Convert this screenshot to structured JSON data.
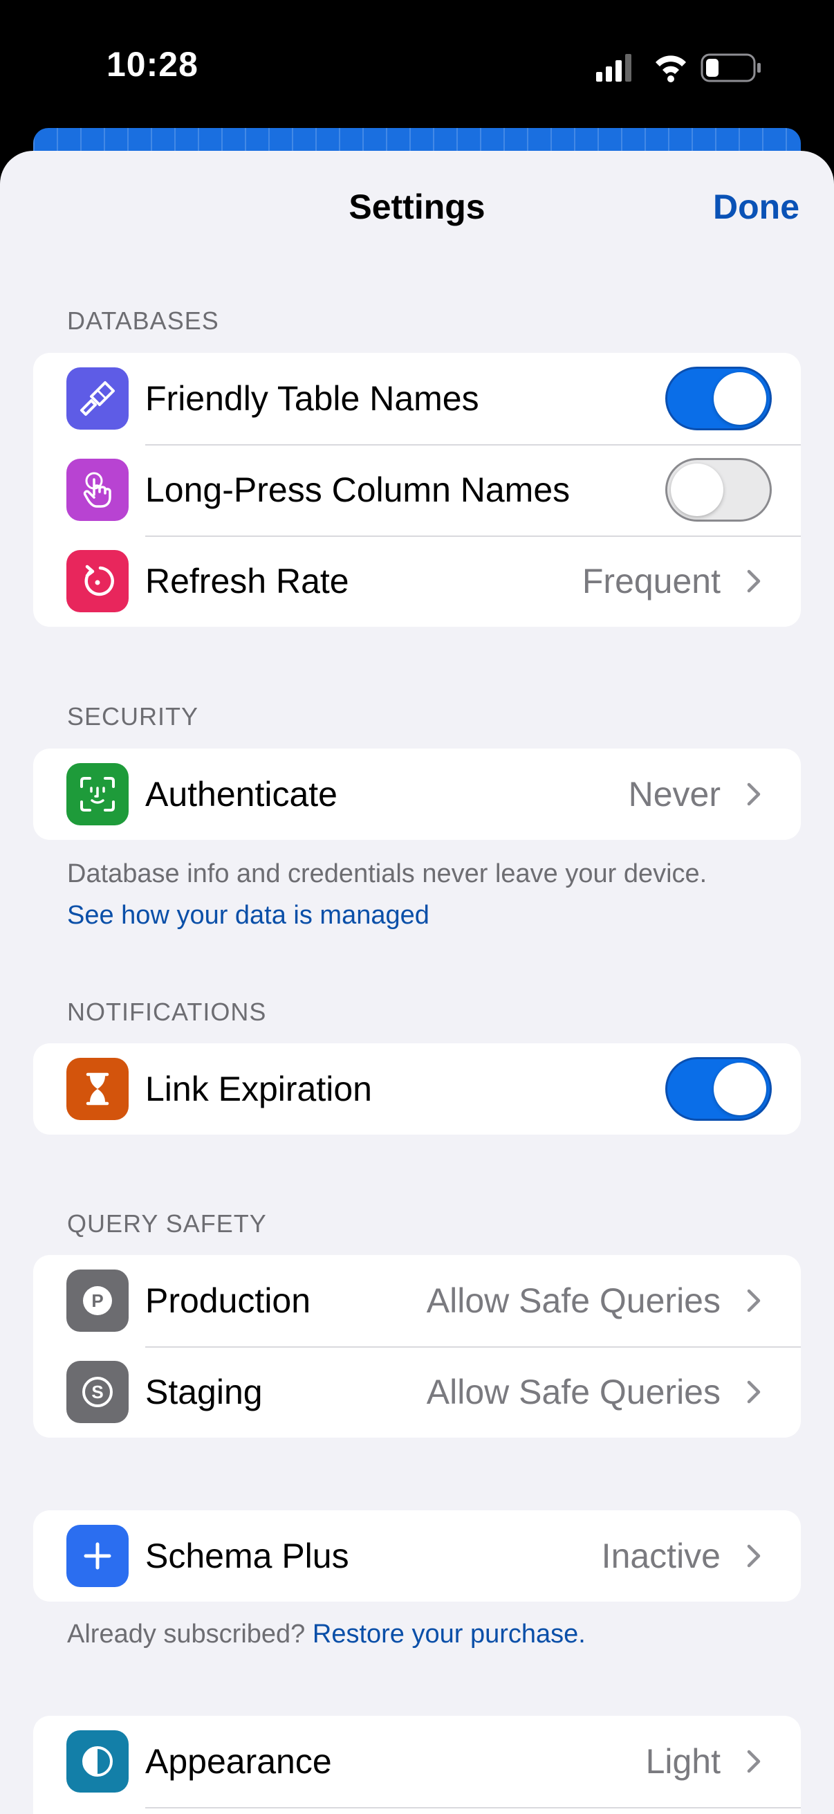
{
  "status_bar": {
    "time": "10:28"
  },
  "nav": {
    "title": "Settings",
    "done_label": "Done"
  },
  "databases": {
    "header": "DATABASES",
    "rows": [
      {
        "label": "Friendly Table Names",
        "toggle": true,
        "icon": "paintbrush-icon",
        "icon_color": "#5e5ce6"
      },
      {
        "label": "Long-Press Column Names",
        "toggle": false,
        "icon": "hand-tap-icon",
        "icon_color": "#b843d2"
      },
      {
        "label": "Refresh Rate",
        "value": "Frequent",
        "icon": "refresh-icon",
        "icon_color": "#e8265c"
      }
    ]
  },
  "security": {
    "header": "SECURITY",
    "rows": [
      {
        "label": "Authenticate",
        "value": "Never",
        "icon": "face-id-icon",
        "icon_color": "#1e9b3a"
      }
    ],
    "footer": "Database info and credentials never leave your device.",
    "footer_link": "See how your data is managed"
  },
  "notifications": {
    "header": "NOTIFICATIONS",
    "rows": [
      {
        "label": "Link Expiration",
        "toggle": true,
        "icon": "hourglass-icon",
        "icon_color": "#d3540c"
      }
    ]
  },
  "query_safety": {
    "header": "QUERY SAFETY",
    "rows": [
      {
        "label": "Production",
        "value": "Allow Safe Queries",
        "icon": "production-p-icon",
        "icon_color": "#6c6c70"
      },
      {
        "label": "Staging",
        "value": "Allow Safe Queries",
        "icon": "staging-s-icon",
        "icon_color": "#6c6c70"
      }
    ]
  },
  "subscription": {
    "rows": [
      {
        "label": "Schema Plus",
        "value": "Inactive",
        "icon": "plus-icon",
        "icon_color": "#2b6ef0"
      }
    ],
    "footer_prefix": "Already subscribed?",
    "footer_link": "Restore your purchase."
  },
  "appearance": {
    "rows": [
      {
        "label": "Appearance",
        "value": "Light",
        "icon": "half-circle-icon",
        "icon_color": "#137fa8"
      }
    ]
  }
}
